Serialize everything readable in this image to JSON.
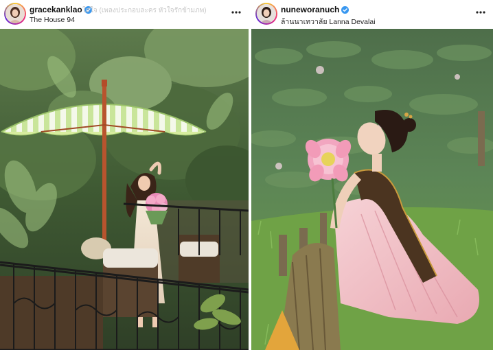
{
  "posts": [
    {
      "username": "gracekanklao",
      "location": "The House 94",
      "faded_caption": "ใส่ใจ (เพลงประกอบละคร หัวใจรักข้ามภพ)",
      "verified": true,
      "avatar_icon": "profile-avatar",
      "menu_icon": "more-options-icon",
      "photo_alt": "Woman in cream dress holding pink flower bouquet under a green and white striped umbrella on a balcony"
    },
    {
      "username": "nuneworanuch",
      "location": "ล้านนาเทวาลัย Lanna Devalai",
      "verified": true,
      "avatar_icon": "profile-avatar",
      "menu_icon": "more-options-icon",
      "photo_alt": "Woman in traditional pink Thai dress holding a pink lotus flower sitting on grass near lotus pond"
    }
  ],
  "colors": {
    "verified": "#3897f0",
    "text": "#111111"
  }
}
